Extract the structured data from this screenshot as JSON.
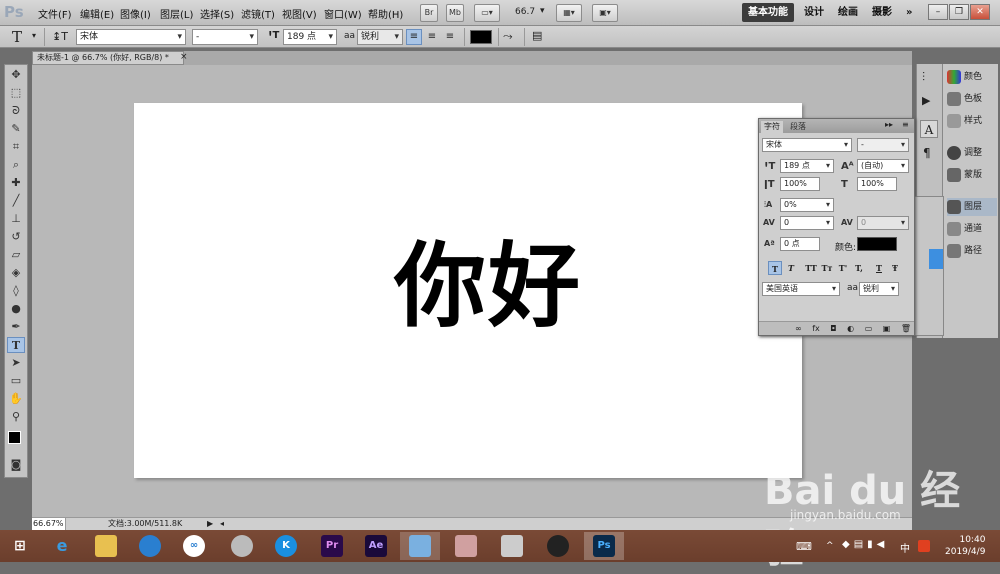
{
  "menubar": {
    "logo": "Ps",
    "items": [
      "文件(F)",
      "编辑(E)",
      "图像(I)",
      "图层(L)",
      "选择(S)",
      "滤镜(T)",
      "视图(V)",
      "窗口(W)",
      "帮助(H)"
    ],
    "bridge": "Br",
    "minibridge": "Mb",
    "zoom": "66.7",
    "workspaces": [
      "基本功能",
      "设计",
      "绘画",
      "摄影"
    ],
    "more": "»"
  },
  "options": {
    "tool_glyph": "T",
    "font_family": "宋体",
    "font_style": "-",
    "font_size": "189 点",
    "aa_label": "aa",
    "antialias": "锐利",
    "color_hex": "#000000"
  },
  "document": {
    "tab_title": "未标题-1 @ 66.7% (你好, RGB/8) *",
    "canvas_text": "你好",
    "zoom_status": "66.67%",
    "doc_info": "文档:3.00M/511.8K"
  },
  "char_panel": {
    "tab_char": "字符",
    "tab_para": "段落",
    "font_family": "宋体",
    "font_style": "-",
    "size": "189 点",
    "leading": "(自动)",
    "vscale": "100%",
    "hscale": "100%",
    "tsume": "0%",
    "kerning": "0",
    "tracking": "0",
    "baseline": "0 点",
    "color_label": "颜色:",
    "style_buttons": [
      "T",
      "T",
      "TT",
      "Tт",
      "T'",
      "T,",
      "T",
      "Ŧ"
    ],
    "language": "美国英语",
    "aa_label": "aa",
    "antialias": "锐利"
  },
  "right_panels": {
    "items": [
      "颜色",
      "色板",
      "样式",
      "调整",
      "蒙版",
      "图层",
      "通道",
      "路径"
    ]
  },
  "taskbar": {
    "time": "10:40",
    "date": "2019/4/9",
    "apps": [
      "Pr",
      "Ae",
      "Ps"
    ],
    "ime": "中"
  },
  "watermark": {
    "brand": "Bai du 经验",
    "url": "jingyan.baidu.com"
  }
}
